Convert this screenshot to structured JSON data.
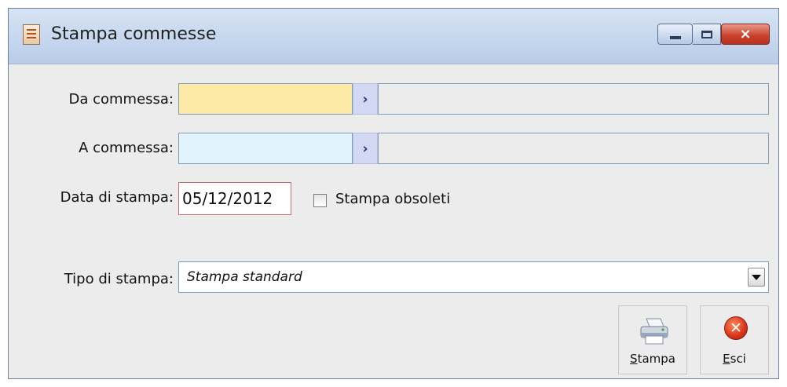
{
  "window": {
    "title": "Stampa commesse",
    "controls": {
      "minimize": "minimize",
      "maximize": "maximize",
      "close": "×"
    }
  },
  "form": {
    "da_commessa": {
      "label": "Da commessa:",
      "value": ""
    },
    "a_commessa": {
      "label": "A commessa:",
      "value": ""
    },
    "data_stampa": {
      "label": "Data di stampa:",
      "value": "05/12/2012"
    },
    "stampa_obsoleti": {
      "label": "Stampa obsoleti",
      "checked": false
    },
    "tipo_stampa": {
      "label": "Tipo di stampa:",
      "value": "Stampa standard"
    }
  },
  "buttons": {
    "stampa": {
      "label_accel": "S",
      "label_rest": "tampa"
    },
    "esci": {
      "label_accel": "E",
      "label_rest": "sci"
    }
  },
  "icons": {
    "app": "document-icon",
    "zoom": "chevron-right-icon",
    "print": "printer-icon",
    "exit": "close-circle-icon"
  },
  "colors": {
    "mandatory_field": "#fde9a6",
    "optional_field": "#e3f3fd",
    "date_border": "#c9676f",
    "zoom_button": "#d3d9f2"
  }
}
